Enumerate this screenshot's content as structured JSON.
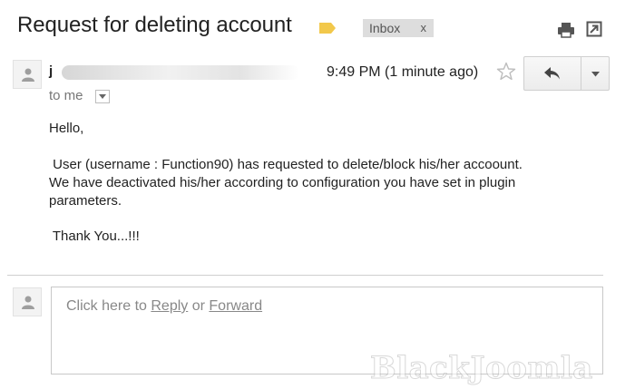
{
  "email": {
    "subject": "Request for deleting account",
    "label": {
      "name": "Inbox",
      "remove": "x"
    },
    "label_tag_color": "#f2c84b",
    "sender": {
      "initial": "j"
    },
    "time": "9:49 PM (1 minute ago)",
    "to": "to me",
    "body": {
      "greeting": "Hello,",
      "line1": " User (username : Function90) has requested to delete/block his/her accoount.",
      "line2": "We have deactivated his/her according to configuration you have set in plugin",
      "line3": "parameters.",
      "signoff": " Thank You...!!!"
    }
  },
  "reply": {
    "prefix": "Click here to ",
    "reply_link": "Reply",
    "middle": " or ",
    "forward_link": "Forward"
  },
  "watermark": {
    "text": "BlackJoomla"
  },
  "colors": {
    "accent_gray": "#dddddd",
    "text": "#222222",
    "muted": "#888888"
  }
}
